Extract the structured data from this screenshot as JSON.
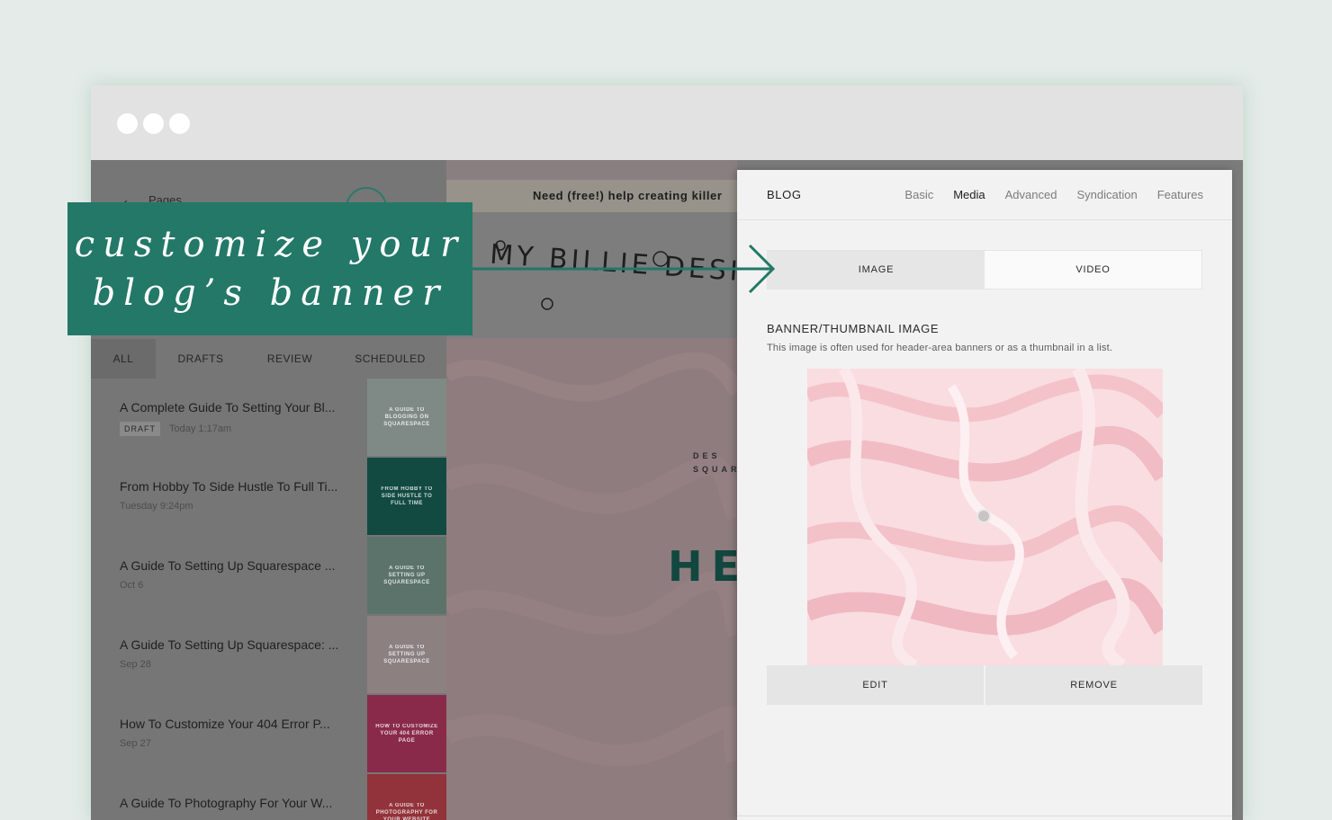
{
  "window": {
    "controls": [
      "dot-1",
      "dot-2",
      "dot-3"
    ]
  },
  "pages_panel": {
    "back_label": "Pages",
    "filters": [
      {
        "label": "ALL",
        "active": true
      },
      {
        "label": "DRAFTS",
        "active": false
      },
      {
        "label": "REVIEW",
        "active": false
      },
      {
        "label": "SCHEDULED",
        "active": false
      }
    ],
    "posts": [
      {
        "title": "A Complete Guide To Setting Your Bl...",
        "badge": "DRAFT",
        "date": "Today 1:17am",
        "thumb_text": "A GUIDE to BLOGGING on SQUARESPACE",
        "thumb_color": "#7f8a86"
      },
      {
        "title": "From Hobby To Side Hustle To Full Ti...",
        "badge": "",
        "date": "Tuesday 9:24pm",
        "thumb_text": "from HOBBY to SIDE HUSTLE to FULL TIME",
        "thumb_color": "#124a41"
      },
      {
        "title": "A Guide To Setting Up Squarespace ...",
        "badge": "",
        "date": "Oct 6",
        "thumb_text": "A GUIDE to SETTING UP SQUARESPACE",
        "thumb_color": "#5b736b"
      },
      {
        "title": "A Guide To Setting Up Squarespace: ...",
        "badge": "",
        "date": "Sep 28",
        "thumb_text": "A GUIDE to SETTING UP SQUARESPACE",
        "thumb_color": "#8c8080"
      },
      {
        "title": "How To Customize Your 404 Error P...",
        "badge": "",
        "date": "Sep 27",
        "thumb_text": "HOW TO CUSTOMIZE YOUR 404 ERROR PAGE",
        "thumb_color": "#8a2a4a"
      },
      {
        "title": "A Guide To Photography For Your W...",
        "badge": "",
        "date": "",
        "thumb_text": "A GUIDE to PHOTOGRAPHY for your WEBSITE",
        "thumb_color": "#92323a"
      }
    ]
  },
  "preview": {
    "announcement": "Need (free!) help creating killer",
    "logo": "MY BILLIE DESIGNS",
    "tagline": "DES\nSQUAR",
    "hero_heading": "HELL"
  },
  "settings_panel": {
    "title": "BLOG",
    "tabs": [
      {
        "label": "Basic",
        "active": false
      },
      {
        "label": "Media",
        "active": true
      },
      {
        "label": "Advanced",
        "active": false
      },
      {
        "label": "Syndication",
        "active": false
      },
      {
        "label": "Features",
        "active": false
      }
    ],
    "media_types": [
      {
        "label": "IMAGE",
        "active": true
      },
      {
        "label": "VIDEO",
        "active": false
      }
    ],
    "section_label": "BANNER/THUMBNAIL IMAGE",
    "section_help": "This image is often used for header-area banners or as a thumbnail in a list.",
    "image_actions": {
      "edit": "EDIT",
      "remove": "REMOVE"
    }
  },
  "callout": {
    "text": "customize your\nblog’s banner",
    "color": "#237868"
  }
}
